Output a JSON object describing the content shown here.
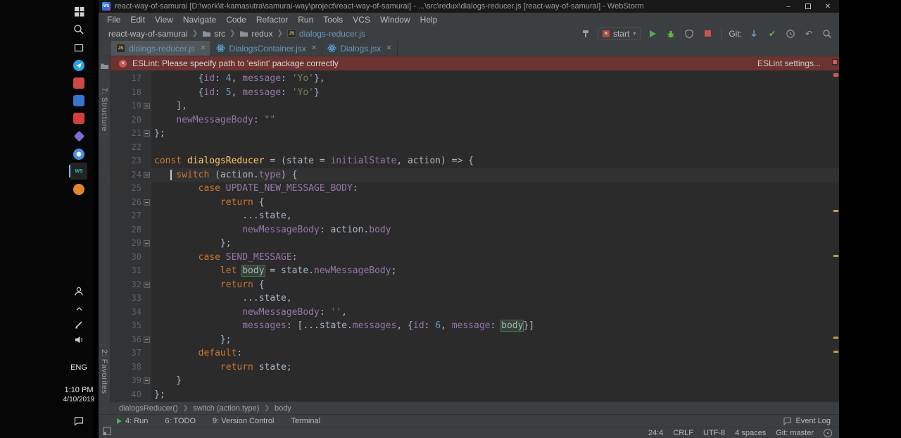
{
  "window": {
    "title": "react-way-of-samurai [D:\\work\\it-kamasutra\\samurai-way\\project\\react-way-of-samurai] - ...\\src\\redux\\dialogs-reducer.js [react-way-of-samurai] - WebStorm"
  },
  "taskbar": {
    "system_icons": [
      "start",
      "search",
      "task-view"
    ],
    "pinned_apps": [
      "telegram",
      "red-app",
      "blue-app",
      "red-app-2",
      "purple-app",
      "browser",
      "webstorm",
      "orange-app"
    ],
    "active_app": "webstorm",
    "tray_icons": [
      "people",
      "hidden-icons",
      "windows-ink",
      "volume",
      "notifications"
    ],
    "language": "ENG",
    "time": "1:10 PM",
    "date": "4/10/2019"
  },
  "menu": {
    "items": [
      "File",
      "Edit",
      "View",
      "Navigate",
      "Code",
      "Refactor",
      "Run",
      "Tools",
      "VCS",
      "Window",
      "Help"
    ]
  },
  "navbar": {
    "breadcrumbs": [
      {
        "label": "react-way-of-samurai"
      },
      {
        "label": "src",
        "icon": "folder"
      },
      {
        "label": "redux",
        "icon": "folder"
      },
      {
        "label": "dialogs-reducer.js",
        "icon": "js-file"
      }
    ],
    "run_config": "start",
    "git_label": "Git:"
  },
  "tabs": [
    {
      "label": "dialogs-reducer.js",
      "icon": "js-file",
      "active": true
    },
    {
      "label": "DialogsContainer.jsx",
      "icon": "react-file",
      "active": false
    },
    {
      "label": "Dialogs.jsx",
      "icon": "react-file",
      "active": false
    }
  ],
  "banner": {
    "message": "ESLint: Please specify path to 'eslint' package correctly",
    "action": "ESLint settings..."
  },
  "tool_stripe": {
    "structure": "7: Structure",
    "favorites": "2: Favorites"
  },
  "editor": {
    "current_line": 24,
    "fold_lines": [
      19,
      21,
      24,
      26,
      29,
      32,
      36,
      39
    ],
    "lines": [
      {
        "n": 17,
        "t": [
          [
            "p",
            "        {"
          ],
          [
            "prop",
            "id"
          ],
          [
            "p",
            ": "
          ],
          [
            "num",
            "4"
          ],
          [
            "p",
            ", "
          ],
          [
            "prop",
            "message"
          ],
          [
            "p",
            ": "
          ],
          [
            "str",
            "'Yo'"
          ],
          [
            "p",
            "},"
          ]
        ]
      },
      {
        "n": 18,
        "t": [
          [
            "p",
            "        {"
          ],
          [
            "prop",
            "id"
          ],
          [
            "p",
            ": "
          ],
          [
            "num",
            "5"
          ],
          [
            "p",
            ", "
          ],
          [
            "prop",
            "message"
          ],
          [
            "p",
            ": "
          ],
          [
            "str",
            "'Yo'"
          ],
          [
            "p",
            "}"
          ]
        ]
      },
      {
        "n": 19,
        "t": [
          [
            "p",
            "    ],"
          ]
        ]
      },
      {
        "n": 20,
        "t": [
          [
            "p",
            "    "
          ],
          [
            "prop",
            "newMessageBody"
          ],
          [
            "p",
            ": "
          ],
          [
            "str",
            "\"\""
          ]
        ]
      },
      {
        "n": 21,
        "t": [
          [
            "p",
            "};"
          ]
        ]
      },
      {
        "n": 22,
        "t": []
      },
      {
        "n": 23,
        "t": [
          [
            "kw",
            "const"
          ],
          [
            "p",
            " "
          ],
          [
            "fn",
            "dialogsReducer"
          ],
          [
            "p",
            " = (state = "
          ],
          [
            "const",
            "initialState"
          ],
          [
            "p",
            ", action) => {"
          ]
        ]
      },
      {
        "n": 24,
        "t": [
          [
            "p",
            "   "
          ],
          [
            "caret",
            ""
          ],
          [
            "p",
            " "
          ],
          [
            "kw",
            "switch"
          ],
          [
            "p",
            " (action."
          ],
          [
            "prop",
            "type"
          ],
          [
            "p",
            ") {"
          ]
        ]
      },
      {
        "n": 25,
        "t": [
          [
            "p",
            "        "
          ],
          [
            "kw",
            "case"
          ],
          [
            "p",
            " "
          ],
          [
            "const",
            "UPDATE_NEW_MESSAGE_BODY"
          ],
          [
            "p",
            ":"
          ]
        ]
      },
      {
        "n": 26,
        "t": [
          [
            "p",
            "            "
          ],
          [
            "kw",
            "return"
          ],
          [
            "p",
            " {"
          ]
        ]
      },
      {
        "n": 27,
        "t": [
          [
            "p",
            "                ...state,"
          ]
        ]
      },
      {
        "n": 28,
        "t": [
          [
            "p",
            "                "
          ],
          [
            "prop",
            "newMessageBody"
          ],
          [
            "p",
            ": action."
          ],
          [
            "prop",
            "body"
          ]
        ]
      },
      {
        "n": 29,
        "t": [
          [
            "p",
            "            };"
          ]
        ]
      },
      {
        "n": 30,
        "t": [
          [
            "p",
            "        "
          ],
          [
            "kw",
            "case"
          ],
          [
            "p",
            " "
          ],
          [
            "const",
            "SEND_MESSAGE"
          ],
          [
            "p",
            ":"
          ]
        ]
      },
      {
        "n": 31,
        "t": [
          [
            "p",
            "            "
          ],
          [
            "kw",
            "let"
          ],
          [
            "p",
            " "
          ],
          [
            "hl",
            "body"
          ],
          [
            "p",
            " = state."
          ],
          [
            "prop",
            "newMessageBody"
          ],
          [
            "p",
            ";"
          ]
        ]
      },
      {
        "n": 32,
        "t": [
          [
            "p",
            "            "
          ],
          [
            "kw",
            "return"
          ],
          [
            "p",
            " {"
          ]
        ]
      },
      {
        "n": 33,
        "t": [
          [
            "p",
            "                ...state,"
          ]
        ]
      },
      {
        "n": 34,
        "t": [
          [
            "p",
            "                "
          ],
          [
            "prop",
            "newMessageBody"
          ],
          [
            "p",
            ": "
          ],
          [
            "str",
            "''"
          ],
          [
            "p",
            ","
          ]
        ]
      },
      {
        "n": 35,
        "t": [
          [
            "p",
            "                "
          ],
          [
            "prop",
            "messages"
          ],
          [
            "p",
            ": [...state."
          ],
          [
            "prop",
            "messages"
          ],
          [
            "p",
            ", {"
          ],
          [
            "prop",
            "id"
          ],
          [
            "p",
            ": "
          ],
          [
            "num",
            "6"
          ],
          [
            "p",
            ", "
          ],
          [
            "prop",
            "message"
          ],
          [
            "p",
            ": "
          ],
          [
            "hl",
            "body"
          ],
          [
            "p",
            "}]"
          ]
        ]
      },
      {
        "n": 36,
        "t": [
          [
            "p",
            "            };"
          ]
        ]
      },
      {
        "n": 37,
        "t": [
          [
            "p",
            "        "
          ],
          [
            "kw",
            "default"
          ],
          [
            "p",
            ":"
          ]
        ]
      },
      {
        "n": 38,
        "t": [
          [
            "p",
            "            "
          ],
          [
            "kw",
            "return"
          ],
          [
            "p",
            " state;"
          ]
        ]
      },
      {
        "n": 39,
        "t": [
          [
            "p",
            "    }"
          ]
        ]
      },
      {
        "n": 40,
        "t": [
          [
            "p",
            "};"
          ]
        ]
      }
    ]
  },
  "breadcrumbs_bottom": [
    "dialogsReducer()",
    "switch (action.type)",
    "body"
  ],
  "tool_buttons": [
    "4: Run",
    "6: TODO",
    "9: Version Control",
    "Terminal"
  ],
  "event_log": "Event Log",
  "status_bar": {
    "caret_position": "24:4",
    "line_ending": "CRLF",
    "encoding": "UTF-8",
    "indent": "4 spaces",
    "vcs_branch": "Git: master"
  },
  "colors": {
    "editor_bg": "#2b2b2b",
    "frame_bg": "#3c3f41",
    "gutter_bg": "#313335",
    "banner_bg": "#6c3330",
    "keyword": "#cc7832",
    "string": "#6a8759",
    "number": "#6897bb",
    "property": "#9876aa",
    "function_name": "#ffc66b",
    "plain_text": "#a9b7c6",
    "line_number": "#606366",
    "current_line": "#323232",
    "usage_highlight": "#344134",
    "run_green": "#57a85c",
    "stop_red": "#c75450"
  }
}
